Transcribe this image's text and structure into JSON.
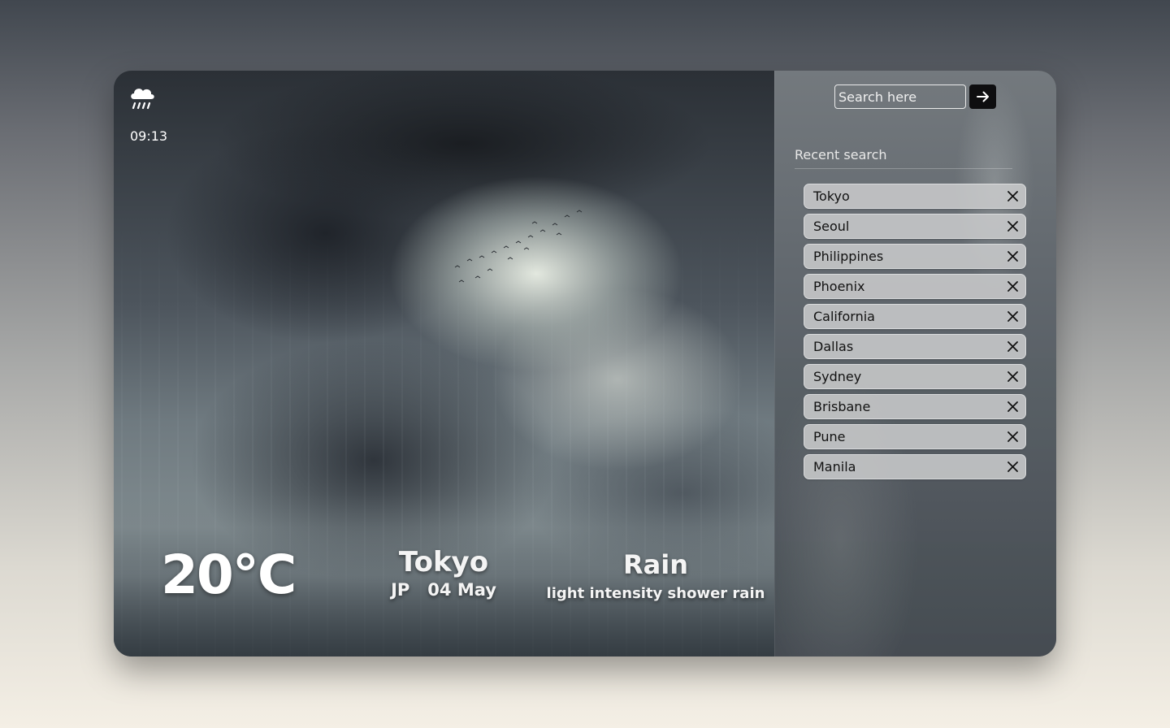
{
  "weather": {
    "icon": "cloud-rain-icon",
    "time": "09:13",
    "temperature": "20°C",
    "city": "Tokyo",
    "country": "JP",
    "date": "04 May",
    "condition": "Rain",
    "description": "light intensity shower rain"
  },
  "search": {
    "placeholder": "Search here",
    "value": "",
    "submit_icon": "arrow-right-icon"
  },
  "recent": {
    "title": "Recent search",
    "remove_icon": "close-icon",
    "items": [
      {
        "label": "Tokyo"
      },
      {
        "label": "Seoul"
      },
      {
        "label": "Philippines"
      },
      {
        "label": "Phoenix"
      },
      {
        "label": "California"
      },
      {
        "label": "Dallas"
      },
      {
        "label": "Sydney"
      },
      {
        "label": "Brisbane"
      },
      {
        "label": "Pune"
      },
      {
        "label": "Manila"
      }
    ]
  },
  "colors": {
    "accent": "#0e0e10",
    "chip_background": "#c8cacb",
    "text_light": "#ffffff"
  }
}
